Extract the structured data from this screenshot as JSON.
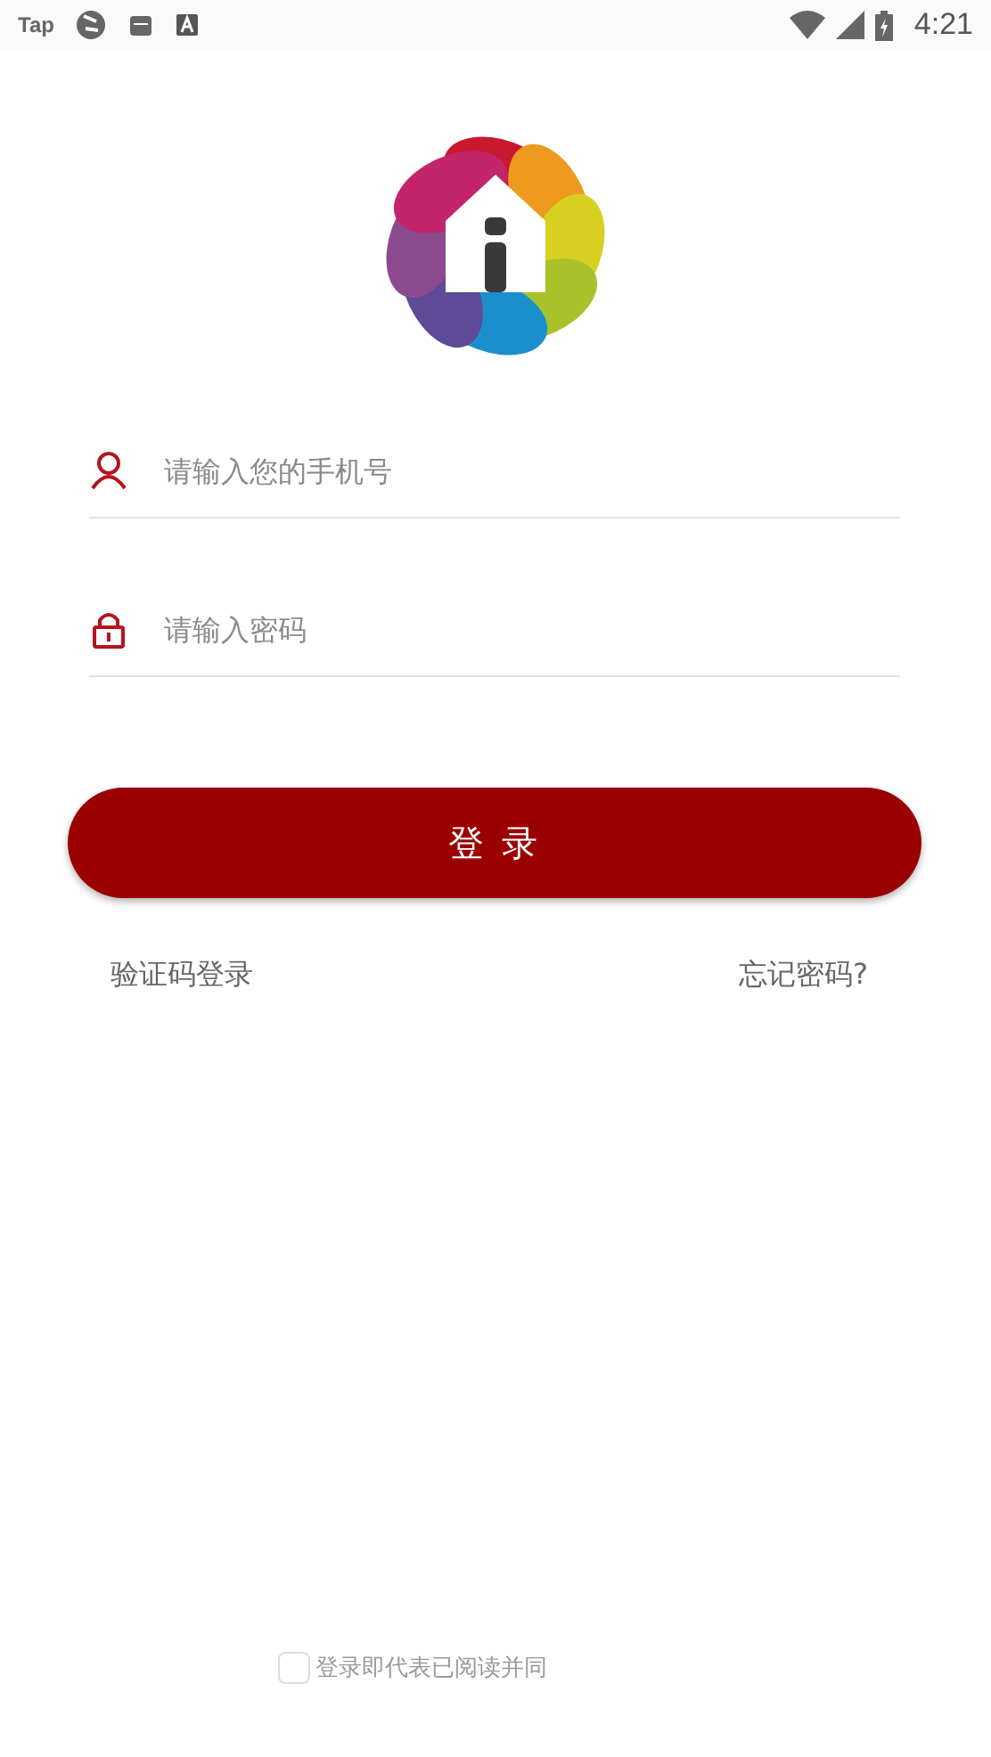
{
  "status_bar": {
    "app_label": "Tap",
    "time": "4:21"
  },
  "login_form": {
    "fields": [
      {
        "kind": "phone",
        "placeholder": "请输入您的手机号"
      },
      {
        "kind": "password",
        "placeholder": "请输入密码"
      }
    ],
    "submit": "登 录",
    "links": [
      "验证码登录",
      "忘记密码?"
    ]
  },
  "agreement": {
    "checked": false,
    "text": "登录即代表已阅读并同"
  }
}
